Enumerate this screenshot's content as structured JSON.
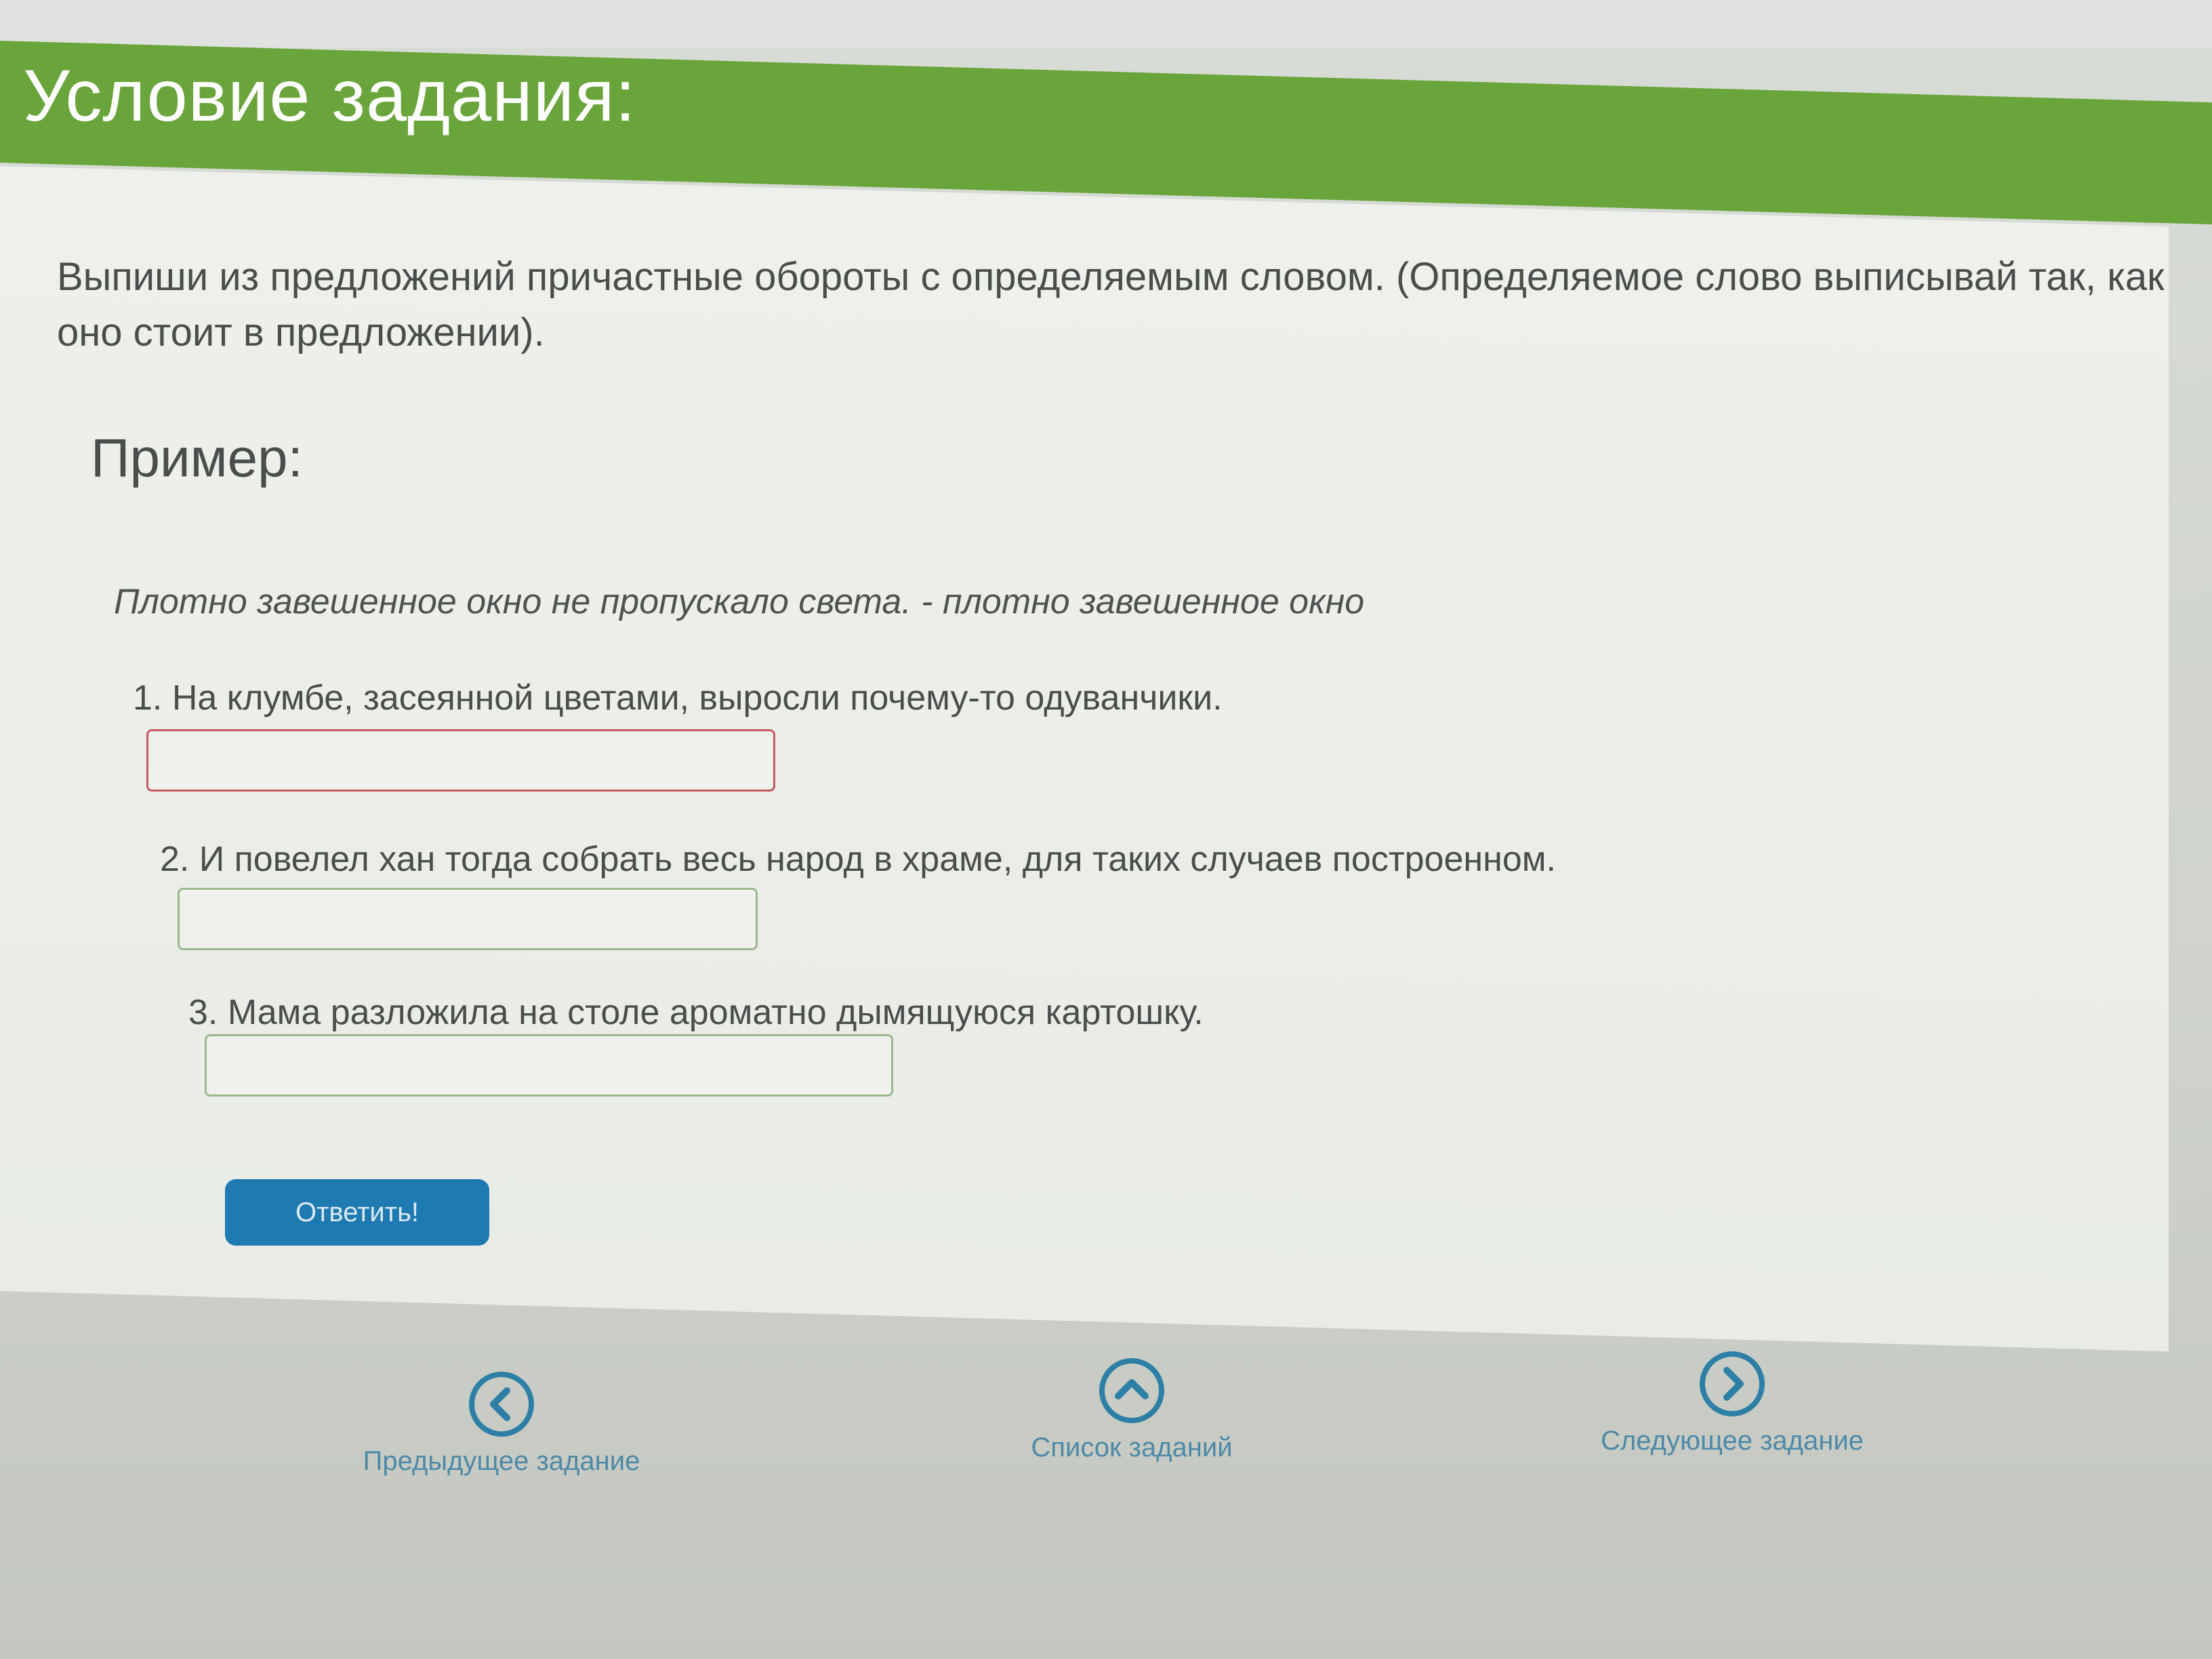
{
  "header": {
    "title": "Условие задания:"
  },
  "task": {
    "instructions": "Выпиши из предложений причастные обороты с определяемым словом. (Определяемое слово выписывай так, как оно стоит в предложении).",
    "example_heading": "Пример:",
    "example_text": "Плотно завешенное окно не пропускало света. - плотно завешенное окно"
  },
  "questions": [
    {
      "text": "1. На клумбе, засеянной цветами, выросли почему-то одуванчики.",
      "value": "",
      "state": "error"
    },
    {
      "text": "2. И повелел хан тогда собрать весь народ в храме, для таких случаев построенном.",
      "value": "",
      "state": "normal"
    },
    {
      "text": "3. Мама разложила на столе ароматно дымящуюся картошку.",
      "value": "",
      "state": "normal"
    }
  ],
  "submit": {
    "label": "Ответить!"
  },
  "navigation": {
    "prev_label": "Предыдущее задание",
    "list_label": "Список заданий",
    "next_label": "Следующее задание"
  },
  "colors": {
    "header_green": "#6aa53c",
    "button_blue": "#1e7ab0",
    "nav_blue": "#4f89a6",
    "error_border": "#c75a5e",
    "input_border": "#9ab98d"
  },
  "icons": {
    "prev": "chevron-left-circle-icon",
    "list": "chevron-up-circle-icon",
    "next": "chevron-right-circle-icon"
  }
}
